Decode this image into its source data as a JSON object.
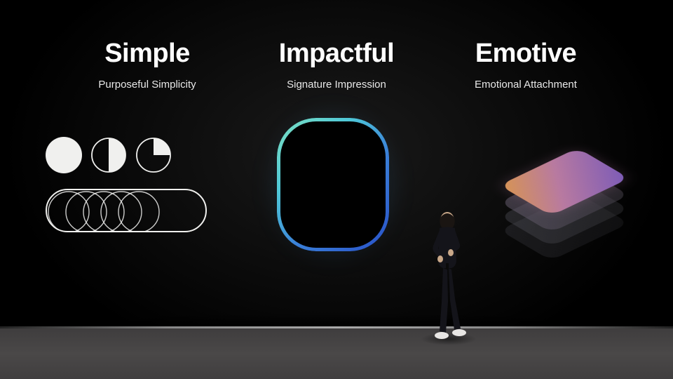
{
  "columns": [
    {
      "heading": "Simple",
      "subheading": "Purposeful Simplicity"
    },
    {
      "heading": "Impactful",
      "subheading": "Signature Impression"
    },
    {
      "heading": "Emotive",
      "subheading": "Emotional Attachment"
    }
  ]
}
